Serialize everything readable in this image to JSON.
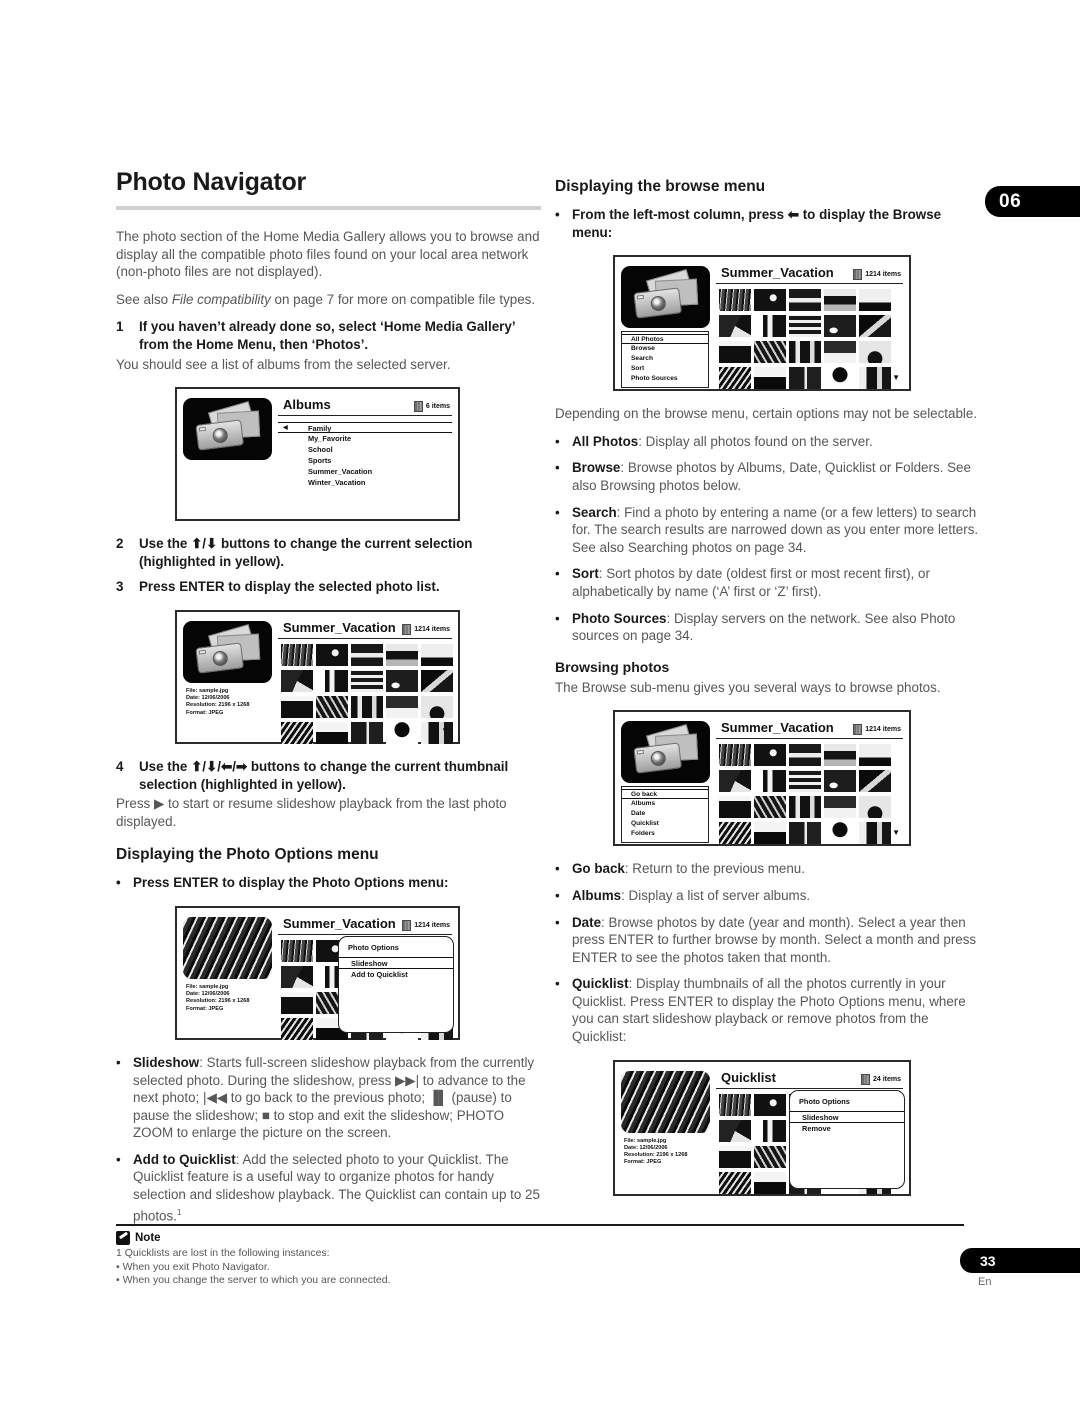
{
  "chapter_tab": "06",
  "page_number": "33",
  "page_language": "En",
  "left": {
    "title": "Photo Navigator",
    "intro1": "The photo section of the Home Media Gallery allows you to browse and display all the compatible photo files found on your local area network (non-photo files are not displayed).",
    "intro2_pre": "See also ",
    "intro2_italic": "File compatibility",
    "intro2_post": " on page 7 for more on compatible file types.",
    "step1_num": "1",
    "step1_text": "If you haven’t already done so, select ‘Home Media Gallery’ from the Home Menu, then ‘Photos’.",
    "step1_body": "You should see a list of albums from the selected server.",
    "step2_num": "2",
    "step2_text": "Use the ⬆/⬇ buttons to change the current selection (highlighted in yellow).",
    "step3_num": "3",
    "step3_text": "Press ENTER to display the selected photo list.",
    "step4_num": "4",
    "step4_text": "Use the ⬆/⬇/⬅/➡ buttons to change the current thumbnail selection (highlighted in yellow).",
    "step4_body": "Press ▶ to start or resume slideshow playback from the last photo displayed.",
    "options_heading": "Displaying the Photo Options menu",
    "options_bullet": "Press ENTER to display the Photo Options menu:",
    "slideshow_term": "Slideshow",
    "slideshow_desc": ": Starts full-screen slideshow playback from the currently selected photo. During the slideshow, press ▶▶| to advance to the next photo; |◀◀ to go back to the previous photo; ▐▌ (pause) to pause the slideshow; ■ to stop and exit the slideshow; PHOTO ZOOM to enlarge the picture on the screen.",
    "quicklist_term": "Add to Quicklist",
    "quicklist_desc": ": Add the selected photo to your Quicklist. The Quicklist feature is a useful way to organize photos for handy selection and slideshow playback. The Quicklist can contain up to 25 photos."
  },
  "right": {
    "browse_heading": "Displaying the browse menu",
    "browse_bullet": "From the left-most column, press ⬅ to display the Browse menu:",
    "browse_note": "Depending on the browse menu, certain options may not be selectable.",
    "items": [
      {
        "term": "All Photos",
        "desc": ": Display all photos found on the server."
      },
      {
        "term": "Browse",
        "desc": ": Browse photos by Albums, Date, Quicklist or Folders. See also Browsing photos below."
      },
      {
        "term": "Search",
        "desc": ": Find a photo by entering a name (or a few letters) to search for. The search results are narrowed down as you enter more letters. See also Searching photos on page 34."
      },
      {
        "term": "Sort",
        "desc": ": Sort photos by date (oldest first or most recent first), or alphabetically by name (‘A’ first or ‘Z’ first)."
      },
      {
        "term": "Photo Sources",
        "desc": ": Display servers on the network. See also Photo sources on page 34."
      }
    ],
    "browsing_heading": "Browsing photos",
    "browsing_body": "The Browse sub-menu gives you several ways to browse photos.",
    "items2": [
      {
        "term": "Go back",
        "desc": ": Return to the previous menu."
      },
      {
        "term": "Albums",
        "desc": ": Display a list of server albums."
      },
      {
        "term": "Date",
        "desc": ": Browse photos by date (year and month). Select a year then press ENTER to further browse by month. Select a month and press ENTER to see the photos taken that month."
      },
      {
        "term": "Quicklist",
        "desc": ": Display thumbnails of all the photos currently in your Quicklist. Press ENTER to display the Photo Options menu, where you can start slideshow playback or remove photos from the Quicklist:"
      }
    ]
  },
  "figures": {
    "albums": {
      "title": "Albums",
      "count": "6 items",
      "rows": [
        "Family",
        "My_Favorite",
        "School",
        "Sports",
        "Summer_Vacation",
        "Winter_Vacation"
      ],
      "selected_index": 0
    },
    "thumbs": {
      "title": "Summer_Vacation",
      "count": "1214 items",
      "file_info": "File: sample.jpg\nDate: 12/06/2006\nResolution: 2196 x 1268\nFormat: JPEG"
    },
    "photo_options": {
      "title": "Summer_Vacation",
      "count": "1214 items",
      "file_info": "File: sample.jpg\nDate: 12/06/2006\nResolution: 2196 x 1268\nFormat: JPEG",
      "menu_title": "Photo Options",
      "menu_items": [
        "Slideshow",
        "Add to Quicklist"
      ],
      "selected_index": 0
    },
    "browse_menu": {
      "title": "Summer_Vacation",
      "count": "1214 items",
      "menu_items": [
        "All Photos",
        "Browse",
        "Search",
        "Sort",
        "Photo Sources"
      ],
      "selected_index": 0
    },
    "browse_sub": {
      "title": "Summer_Vacation",
      "count": "1214 items",
      "menu_items": [
        "Go back",
        "Albums",
        "Date",
        "Quicklist",
        "Folders"
      ],
      "selected_index": 0
    },
    "quicklist": {
      "title": "Quicklist",
      "count": "24 items",
      "file_info": "File: sample.jpg\nDate: 12/06/2006\nResolution: 2196 x 1268\nFormat: JPEG",
      "menu_title": "Photo Options",
      "menu_items": [
        "Slideshow",
        "Remove"
      ],
      "selected_index": 0
    }
  },
  "note": {
    "label": "Note",
    "line1": "1 Quicklists are lost in the following instances:",
    "line2": "• When you exit Photo Navigator.",
    "line3": "• When you change the server to which you are connected."
  }
}
